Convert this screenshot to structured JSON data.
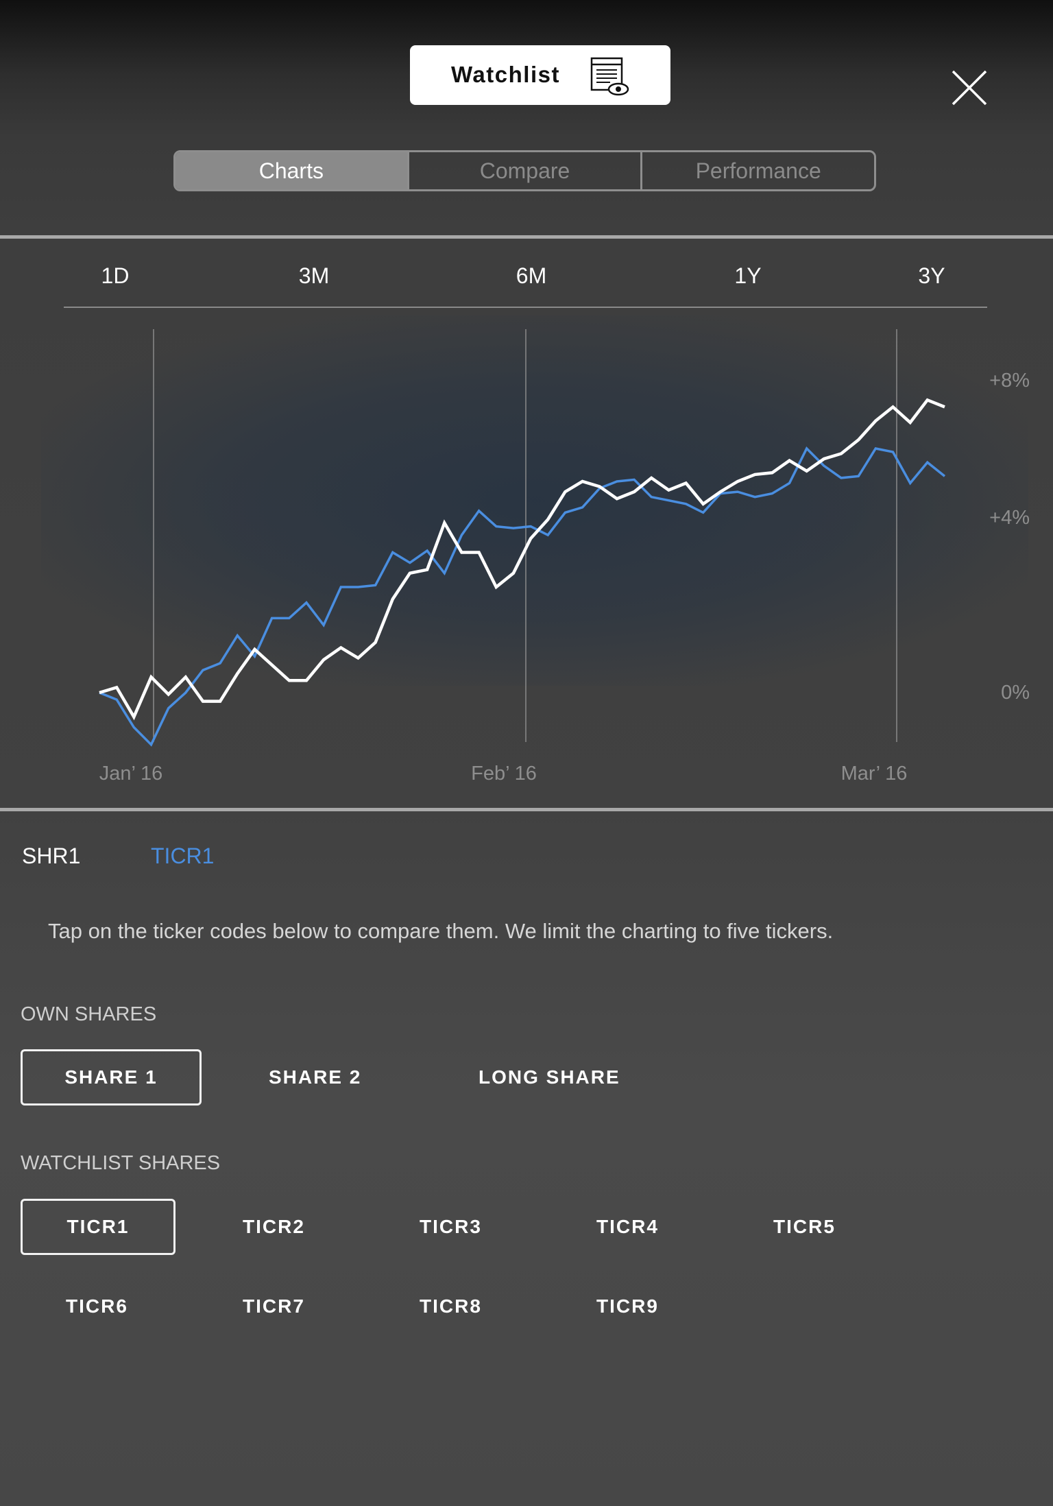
{
  "header": {
    "title": "Watchlist",
    "title_icon": "watchlist-eye-icon",
    "close_icon": "close-icon"
  },
  "tabs": [
    {
      "label": "Charts",
      "active": true
    },
    {
      "label": "Compare",
      "active": false
    },
    {
      "label": "Performance",
      "active": false
    }
  ],
  "ranges": [
    "1D",
    "3M",
    "6M",
    "1Y",
    "3Y"
  ],
  "chart_data": {
    "type": "line",
    "x_ticks": [
      "Jan’ 16",
      "Feb’ 16",
      "Mar’ 16"
    ],
    "y_ticks": [
      "+8%",
      "+4%",
      "0%"
    ],
    "ylim": [
      -1.5,
      9.5
    ],
    "x_range": [
      0,
      52
    ],
    "grid": "vertical lines at month ticks",
    "series": [
      {
        "name": "SHR1",
        "color": "#ffffff",
        "values": [
          0,
          0.15,
          -0.7,
          0.45,
          -0.05,
          0.45,
          -0.25,
          -0.25,
          0.55,
          1.25,
          0.8,
          0.35,
          0.35,
          0.95,
          1.3,
          1.0,
          1.45,
          2.7,
          3.45,
          3.55,
          4.9,
          4.05,
          4.05,
          3.05,
          3.45,
          4.45,
          5.0,
          5.8,
          6.1,
          5.95,
          5.6,
          5.8,
          6.2,
          5.85,
          6.05,
          5.45,
          5.8,
          6.1,
          6.3,
          6.35,
          6.7,
          6.4,
          6.75,
          6.9,
          7.3,
          7.85,
          8.25,
          7.8,
          8.45,
          8.25
        ]
      },
      {
        "name": "TICR1",
        "color": "#4a8ee0",
        "values": [
          0,
          -0.2,
          -1.0,
          -1.5,
          -0.45,
          0,
          0.65,
          0.85,
          1.65,
          1.05,
          2.15,
          2.15,
          2.6,
          1.95,
          3.05,
          3.05,
          3.1,
          4.05,
          3.75,
          4.1,
          3.45,
          4.55,
          5.25,
          4.8,
          4.75,
          4.8,
          4.55,
          5.2,
          5.35,
          5.9,
          6.1,
          6.15,
          5.65,
          5.55,
          5.45,
          5.2,
          5.75,
          5.8,
          5.65,
          5.75,
          6.05,
          7.05,
          6.55,
          6.2,
          6.25,
          7.05,
          6.95,
          6.05,
          6.65,
          6.25
        ]
      }
    ]
  },
  "legend": [
    {
      "label": "SHR1",
      "color": "#ffffff"
    },
    {
      "label": "TICR1",
      "color": "#4a8ee0"
    }
  ],
  "instructions": "Tap on the ticker codes below to compare them. We limit the charting to five tickers.",
  "own_shares": {
    "title": "OWN SHARES",
    "items": [
      {
        "label": "SHARE 1",
        "selected": true
      },
      {
        "label": "SHARE 2",
        "selected": false
      },
      {
        "label": "LONG SHARE",
        "selected": false
      }
    ]
  },
  "watchlist_shares": {
    "title": "WATCHLIST SHARES",
    "items": [
      {
        "label": "TICR1",
        "selected": true
      },
      {
        "label": "TICR2",
        "selected": false
      },
      {
        "label": "TICR3",
        "selected": false
      },
      {
        "label": "TICR4",
        "selected": false
      },
      {
        "label": "TICR5",
        "selected": false
      },
      {
        "label": "TICR6",
        "selected": false
      },
      {
        "label": "TICR7",
        "selected": false
      },
      {
        "label": "TICR8",
        "selected": false
      },
      {
        "label": "TICR9",
        "selected": false
      }
    ]
  }
}
